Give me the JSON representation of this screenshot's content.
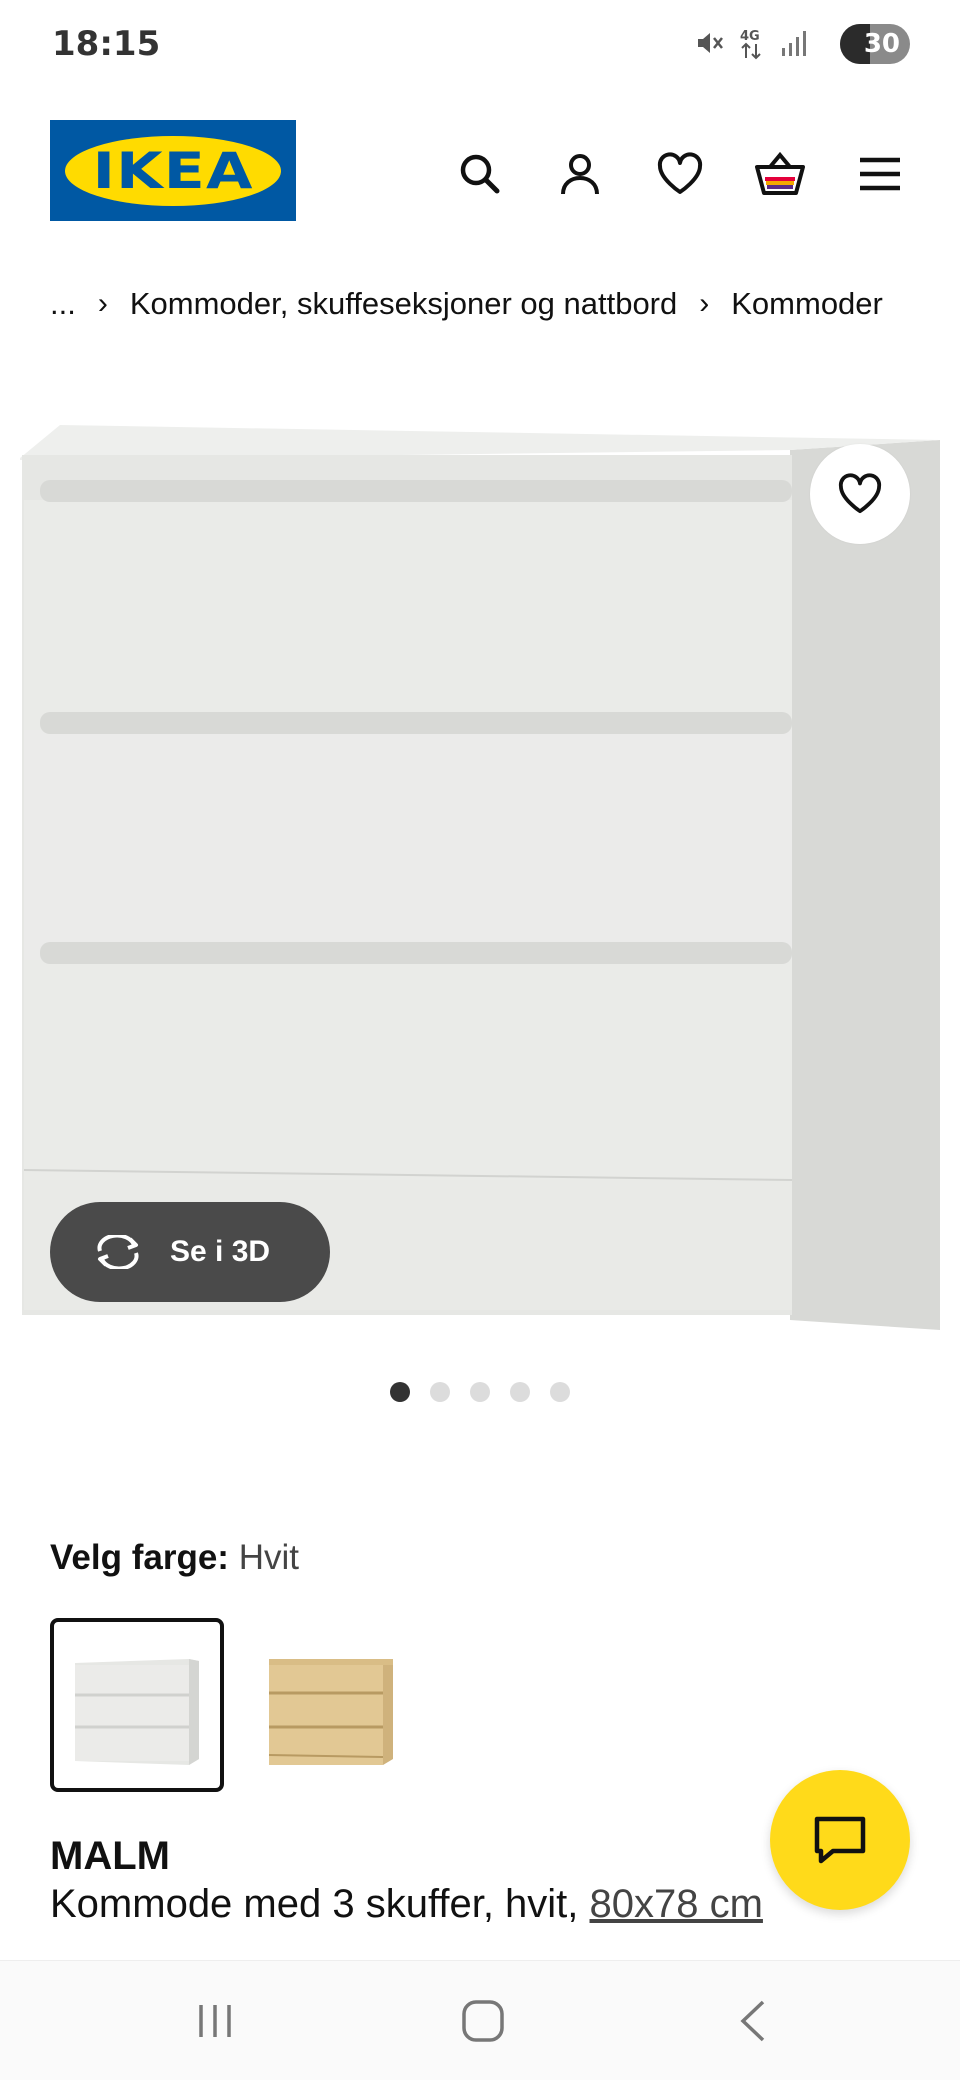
{
  "status_bar": {
    "time": "18:15",
    "battery": "30",
    "icons": [
      "mute-icon",
      "4g-icon",
      "signal-icon",
      "battery-icon"
    ]
  },
  "header": {
    "logo_text": "IKEA",
    "icons": [
      "search-icon",
      "account-icon",
      "heart-icon",
      "cart-icon",
      "menu-icon"
    ],
    "brand_blue": "#0058a3",
    "brand_yellow": "#ffdb00"
  },
  "breadcrumb": {
    "items": [
      "...",
      "Kommoder, skuffeseksjoner og nattbord",
      "Kommoder"
    ]
  },
  "gallery": {
    "view_3d_label": "Se i 3D",
    "dot_count": 5,
    "active_dot": 0
  },
  "color_select": {
    "label": "Velg farge:",
    "value": "Hvit",
    "options": [
      "white-dresser",
      "oak-dresser"
    ]
  },
  "product": {
    "name": "MALM",
    "description": "Kommode med 3 skuffer, hvit, ",
    "size": "80x78 cm"
  },
  "chat": {
    "icon": "chat-icon",
    "color": "#ffda1a"
  },
  "nav_bar": {
    "buttons": [
      "recent-apps-icon",
      "home-icon",
      "back-icon"
    ]
  }
}
